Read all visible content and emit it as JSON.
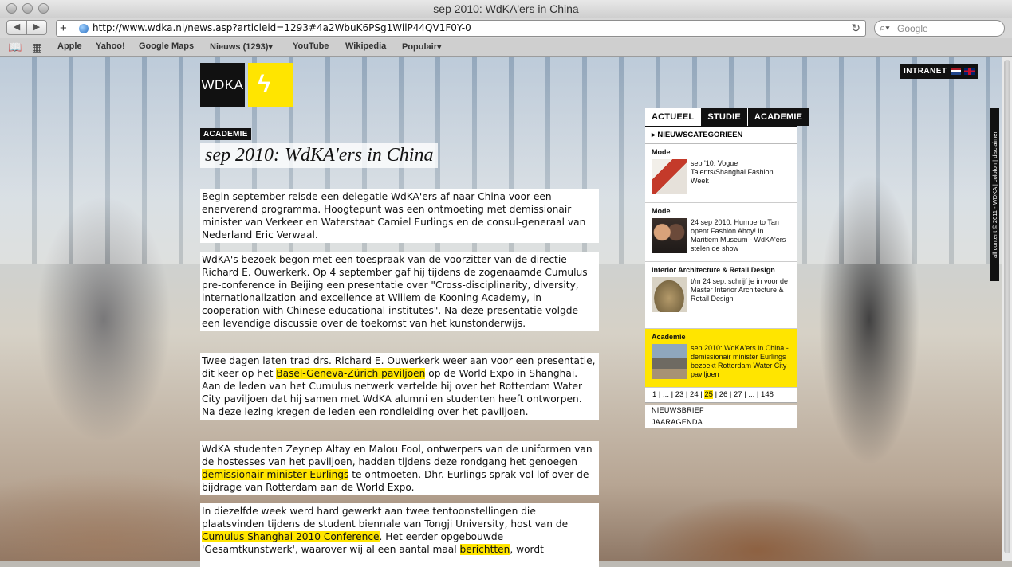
{
  "browser": {
    "window_title": "sep 2010: WdKA'ers in China",
    "url": "http://www.wdka.nl/news.asp?articleid=1293#4a2WbuK6PSg1WilP44QV1F0Y-0",
    "search_placeholder": "Google",
    "bookmarks": [
      "Apple",
      "Yahoo!",
      "Google Maps",
      "Nieuws (1293)▾",
      "YouTube",
      "Wikipedia",
      "Populair▾"
    ]
  },
  "header": {
    "logo_text": "WDKA",
    "intranet_label": "INTRANET"
  },
  "article": {
    "section": "ACADEMIE",
    "title": "sep 2010: WdKA'ers in China",
    "p1": "Begin september reisde een delegatie WdKA'ers af naar China voor een enerverend programma. Hoogtepunt was een ontmoeting met demissionair minister van Verkeer en Waterstaat Camiel Eurlings en de consul-generaal van Nederland Eric Verwaal.",
    "p2": "WdKA's bezoek begon met een toespraak van de voorzitter van de directie Richard E. Ouwerkerk. Op 4 september gaf hij tijdens de zogenaamde Cumulus pre-conference in Beijing een presentatie over \"Cross-disciplinarity, diversity, internationalization and excellence at Willem de Kooning Academy, in cooperation with Chinese educational institutes\". Na deze presentatie volgde een levendige discussie over de toekomst van het kunstonderwijs.",
    "p3a": "Twee dagen laten trad drs. Richard E. Ouwerkerk weer aan voor een presentatie, dit keer op het ",
    "p3_link": "Basel-Geneva-Zürich paviljoen",
    "p3b": " op de World Expo in Shanghai. Aan de leden van het Cumulus netwerk vertelde hij over het Rotterdam Water City paviljoen dat hij samen met WdKA alumni en studenten heeft ontworpen. Na deze lezing kregen de leden een rondleiding over het paviljoen.",
    "p4a": "WdKA studenten Zeynep Altay en Malou Fool, ontwerpers van de uniformen van de hostesses van het paviljoen, hadden tijdens deze rondgang het genoegen ",
    "p4_link": "demissionair minister Eurlings",
    "p4b": " te ontmoeten. Dhr. Eurlings sprak vol lof over de bijdrage van Rotterdam aan de World Expo.",
    "p5a": "In diezelfde week werd hard gewerkt aan twee tentoonstellingen die plaatsvinden tijdens de student biennale van Tongji University, host van de ",
    "p5_link1": "Cumulus Shanghai 2010 Conference",
    "p5b": ". Het eerder opgebouwde 'Gesamtkunstwerk', waarover wij al een aantal maal ",
    "p5_link2": "berichtten",
    "p5c": ", wordt"
  },
  "sidebar": {
    "tabs": [
      "ACTUEEL",
      "STUDIE",
      "ACADEMIE"
    ],
    "categories_label": "NIEUWSCATEGORIEËN",
    "news": [
      {
        "category": "Mode",
        "text": "sep '10: Vogue Talents/Shanghai Fashion Week"
      },
      {
        "category": "Mode",
        "text": "24 sep 2010: Humberto Tan opent Fashion Ahoy! in Maritiem Museum - WdKA'ers stelen de show"
      },
      {
        "category": "Interior Architecture & Retail Design",
        "text": "t/m 24 sep: schrijf je in voor de Master Interior Architecture & Retail Design"
      },
      {
        "category": "Academie",
        "text": "sep 2010: WdKA'ers in China - demissionair minister Eurlings bezoekt Rotterdam Water City paviljoen"
      }
    ],
    "pager": [
      "1",
      "...",
      "23",
      "24",
      "25",
      "26",
      "27",
      "...",
      "148"
    ],
    "pager_active": "25",
    "links": [
      "NIEUWSBRIEF",
      "JAARAGENDA"
    ]
  },
  "vertical_text": "all content © 2011 - WDKA | colofon | disclaimer"
}
